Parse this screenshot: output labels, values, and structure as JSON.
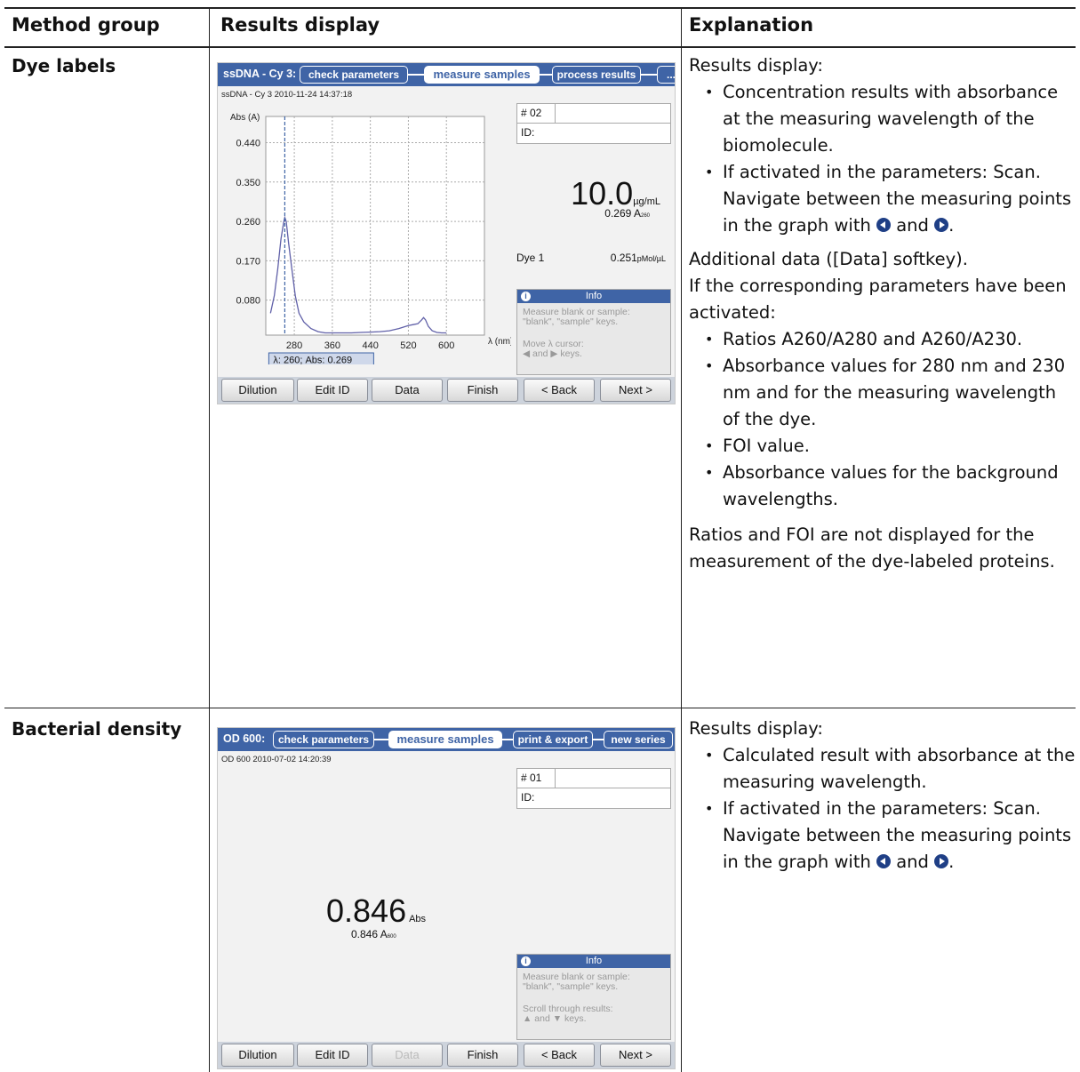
{
  "header": {
    "col1": "Method group",
    "col2": "Results display",
    "col3": "Explanation"
  },
  "rows": [
    {
      "group": "Dye labels",
      "screen": {
        "title": "ssDNA - Cy 3:",
        "tabs": [
          "check parameters",
          "measure samples",
          "process results",
          "..."
        ],
        "active_tab": "measure samples",
        "stamp": "ssDNA - Cy 3 2010-11-24 14:37:18",
        "sample_no": "# 02",
        "id_label": "ID:",
        "main_value": "10.0",
        "main_unit": "µg/mL",
        "sub_value": "0.269",
        "sub_unit": "A",
        "sub_sub": "260",
        "dye_label": "Dye 1",
        "dye_value": "0.251",
        "dye_unit": "pMol/µL",
        "info_title": "Info",
        "info_icon": "info-icon",
        "info_lines": [
          "Measure blank or sample:",
          "\"blank\", \"sample\" keys.",
          "",
          "Move λ cursor:",
          "◀ and ▶ keys."
        ],
        "cursor_readout": "λ: 260; Abs: 0.269",
        "softkeys": [
          {
            "label": "Dilution",
            "enabled": true
          },
          {
            "label": "Edit ID",
            "enabled": true
          },
          {
            "label": "Data",
            "enabled": true
          },
          {
            "label": "Finish",
            "enabled": true
          },
          {
            "label": "< Back",
            "enabled": true
          },
          {
            "label": "Next >",
            "enabled": true
          }
        ]
      },
      "chart_data": {
        "type": "line",
        "ylabel": "Abs (A)",
        "xlabel": "λ (nm)",
        "yticks": [
          0.44,
          0.35,
          0.26,
          0.17,
          0.08
        ],
        "ytick_labels": [
          "0.440",
          "0.350",
          "0.260",
          "0.170",
          "0.080"
        ],
        "xticks": [
          280,
          360,
          440,
          520,
          600
        ],
        "xlim": [
          220,
          680
        ],
        "ylim": [
          0.0,
          0.5
        ],
        "grid": true,
        "cursor_x": 260,
        "series": [
          {
            "x": [
              230,
              238,
              245,
              252,
              258,
              260,
              263,
              268,
              275,
              282,
              290,
              300,
              315,
              330,
              345,
              360,
              380,
              400,
              420,
              440,
              460,
              480,
              500,
              520,
              530,
              540,
              548,
              552,
              556,
              562,
              570,
              580,
              590,
              600
            ],
            "y": [
              0.05,
              0.09,
              0.15,
              0.22,
              0.26,
              0.269,
              0.26,
              0.21,
              0.15,
              0.09,
              0.05,
              0.03,
              0.015,
              0.008,
              0.005,
              0.005,
              0.005,
              0.005,
              0.006,
              0.007,
              0.008,
              0.01,
              0.015,
              0.022,
              0.024,
              0.026,
              0.035,
              0.04,
              0.035,
              0.02,
              0.01,
              0.006,
              0.005,
              0.005
            ]
          }
        ]
      },
      "explanation": {
        "intro": "Results display:",
        "bullets_1": [
          "Concentration results with absorbance at the measuring wavelength of the biomolecule.",
          "If activated in the parameters: Scan."
        ],
        "nav_text_a": "Navigate between the measuring points in the graph with",
        "nav_and": "and",
        "nav_period": ".",
        "icon_left": "arrow-left-circle-icon",
        "icon_right": "arrow-right-circle-icon",
        "additional_1": "Additional data ([Data] softkey).",
        "additional_2": "If the corresponding parameters have been activated:",
        "bullets_2": [
          "Ratios A260/A280 and A260/A230.",
          "Absorbance values for 280 nm and 230 nm and for the measuring wavelength of the dye.",
          "FOI value.",
          "Absorbance values for the background wavelengths."
        ],
        "note": "Ratios and FOI are not displayed for the measurement of the dye-labeled proteins."
      }
    },
    {
      "group": "Bacterial density",
      "screen": {
        "title": "OD 600:",
        "tabs": [
          "check parameters",
          "measure samples",
          "print & export",
          "new series"
        ],
        "active_tab": "measure samples",
        "stamp": "OD 600 2010-07-02 14:20:39",
        "sample_no": "# 01",
        "id_label": "ID:",
        "main_value": "0.846",
        "main_unit": "Abs",
        "sub_value": "0.846",
        "sub_unit": "A",
        "sub_sub": "600",
        "info_title": "Info",
        "info_icon": "info-icon",
        "info_lines": [
          "Measure blank or sample:",
          "\"blank\", \"sample\" keys.",
          "",
          "Scroll through results:",
          "▲ and ▼ keys."
        ],
        "softkeys": [
          {
            "label": "Dilution",
            "enabled": true
          },
          {
            "label": "Edit ID",
            "enabled": true
          },
          {
            "label": "Data",
            "enabled": false
          },
          {
            "label": "Finish",
            "enabled": true
          },
          {
            "label": "< Back",
            "enabled": true
          },
          {
            "label": "Next >",
            "enabled": true
          }
        ]
      },
      "explanation": {
        "intro": "Results display:",
        "bullets_1": [
          "Calculated result with absorbance at the measuring wavelength.",
          "If activated in the parameters: Scan."
        ],
        "nav_text_a": "Navigate between the measuring points in the graph with",
        "nav_and": "and",
        "nav_period": ".",
        "icon_left": "arrow-left-circle-icon",
        "icon_right": "arrow-right-circle-icon"
      }
    }
  ]
}
